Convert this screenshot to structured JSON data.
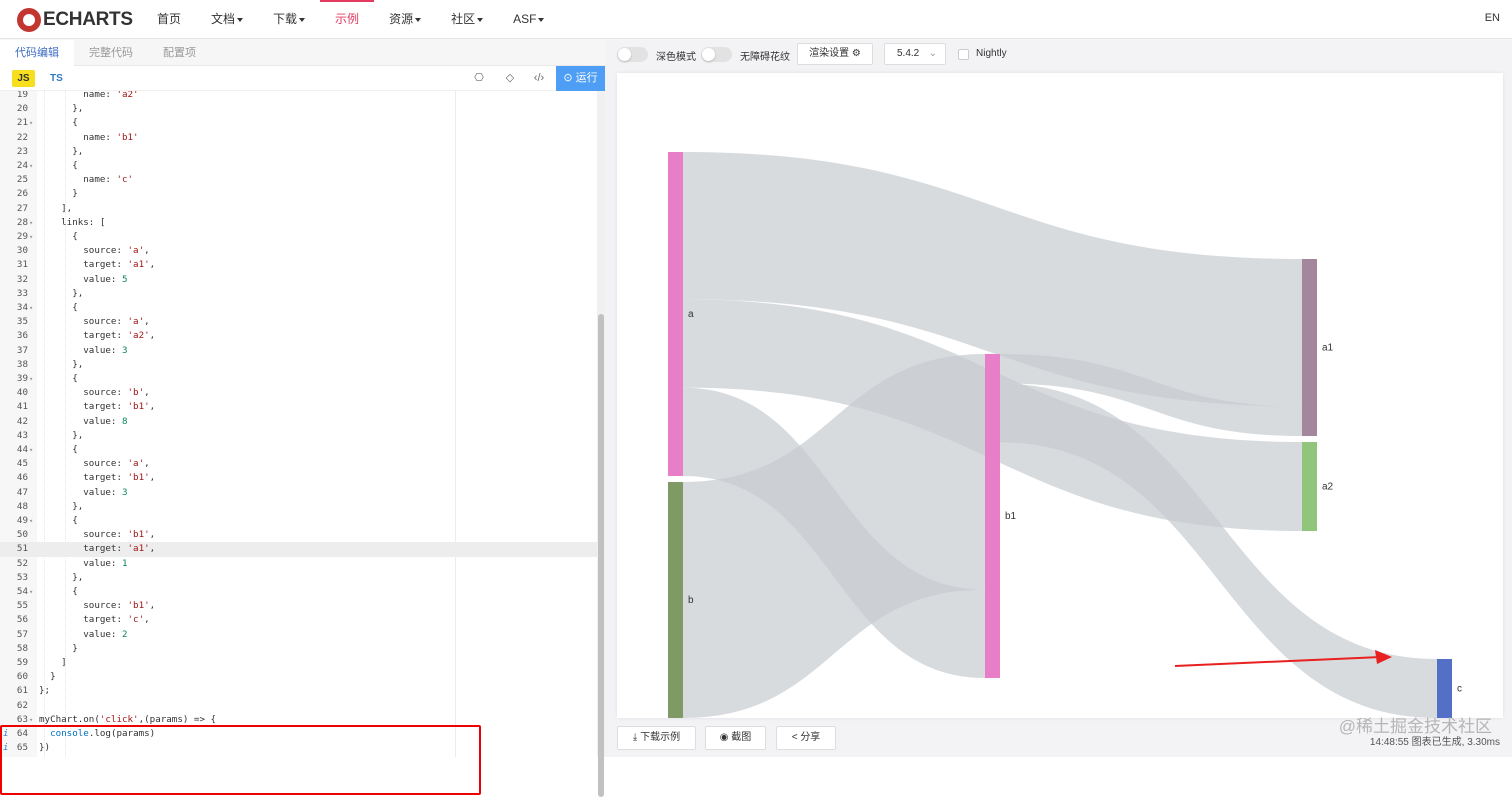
{
  "header": {
    "logo_text": "ECHARTS",
    "nav": [
      {
        "label": "首页",
        "dropdown": false,
        "active": false
      },
      {
        "label": "文档",
        "dropdown": true,
        "active": false
      },
      {
        "label": "下载",
        "dropdown": true,
        "active": false
      },
      {
        "label": "示例",
        "dropdown": false,
        "active": true
      },
      {
        "label": "资源",
        "dropdown": true,
        "active": false
      },
      {
        "label": "社区",
        "dropdown": true,
        "active": false
      },
      {
        "label": "ASF",
        "dropdown": true,
        "active": false
      }
    ],
    "lang": "EN",
    "accent_color": "#e43961"
  },
  "editor": {
    "tabs": [
      "代码编辑",
      "完整代码",
      "配置项"
    ],
    "lang_js": "JS",
    "lang_ts": "TS",
    "run_label": "运行",
    "lines": [
      {
        "no": "19",
        "text": "        name: 'a2'",
        "fold": false
      },
      {
        "no": "20",
        "text": "      },",
        "fold": false
      },
      {
        "no": "21",
        "text": "      {",
        "fold": true
      },
      {
        "no": "22",
        "text": "        name: 'b1'",
        "fold": false
      },
      {
        "no": "23",
        "text": "      },",
        "fold": false
      },
      {
        "no": "24",
        "text": "      {",
        "fold": true
      },
      {
        "no": "25",
        "text": "        name: 'c'",
        "fold": false
      },
      {
        "no": "26",
        "text": "      }",
        "fold": false
      },
      {
        "no": "27",
        "text": "    ],",
        "fold": false
      },
      {
        "no": "28",
        "text": "    links: [",
        "fold": true
      },
      {
        "no": "29",
        "text": "      {",
        "fold": true
      },
      {
        "no": "30",
        "text": "        source: 'a',",
        "fold": false
      },
      {
        "no": "31",
        "text": "        target: 'a1',",
        "fold": false
      },
      {
        "no": "32",
        "text": "        value: 5",
        "fold": false
      },
      {
        "no": "33",
        "text": "      },",
        "fold": false
      },
      {
        "no": "34",
        "text": "      {",
        "fold": true
      },
      {
        "no": "35",
        "text": "        source: 'a',",
        "fold": false
      },
      {
        "no": "36",
        "text": "        target: 'a2',",
        "fold": false
      },
      {
        "no": "37",
        "text": "        value: 3",
        "fold": false
      },
      {
        "no": "38",
        "text": "      },",
        "fold": false
      },
      {
        "no": "39",
        "text": "      {",
        "fold": true
      },
      {
        "no": "40",
        "text": "        source: 'b',",
        "fold": false
      },
      {
        "no": "41",
        "text": "        target: 'b1',",
        "fold": false
      },
      {
        "no": "42",
        "text": "        value: 8",
        "fold": false
      },
      {
        "no": "43",
        "text": "      },",
        "fold": false
      },
      {
        "no": "44",
        "text": "      {",
        "fold": true
      },
      {
        "no": "45",
        "text": "        source: 'a',",
        "fold": false
      },
      {
        "no": "46",
        "text": "        target: 'b1',",
        "fold": false
      },
      {
        "no": "47",
        "text": "        value: 3",
        "fold": false
      },
      {
        "no": "48",
        "text": "      },",
        "fold": false
      },
      {
        "no": "49",
        "text": "      {",
        "fold": true
      },
      {
        "no": "50",
        "text": "        source: 'b1',",
        "fold": false
      },
      {
        "no": "51",
        "text": "        target: 'a1',",
        "fold": false,
        "highlight": true
      },
      {
        "no": "52",
        "text": "        value: 1",
        "fold": false
      },
      {
        "no": "53",
        "text": "      },",
        "fold": false
      },
      {
        "no": "54",
        "text": "      {",
        "fold": true
      },
      {
        "no": "55",
        "text": "        source: 'b1',",
        "fold": false
      },
      {
        "no": "56",
        "text": "        target: 'c',",
        "fold": false
      },
      {
        "no": "57",
        "text": "        value: 2",
        "fold": false
      },
      {
        "no": "58",
        "text": "      }",
        "fold": false
      },
      {
        "no": "59",
        "text": "    ]",
        "fold": false
      },
      {
        "no": "60",
        "text": "  }",
        "fold": false
      },
      {
        "no": "61",
        "text": "};",
        "fold": false
      },
      {
        "no": "62",
        "text": "",
        "fold": false
      },
      {
        "no": "63",
        "text": "myChart.on('click',(params) => {",
        "fold": true
      },
      {
        "no": "64",
        "text": "  console.log(params)",
        "fold": false,
        "info": true
      },
      {
        "no": "65",
        "text": "})",
        "fold": false,
        "info": true
      }
    ]
  },
  "preview": {
    "dark_mode_label": "深色模式",
    "decal_label": "无障碍花纹",
    "render_settings_label": "渲染设置",
    "version": "5.4.2",
    "nightly_label": "Nightly",
    "download_label": "下载示例",
    "screenshot_label": "截图",
    "share_label": "分享",
    "status_time": "14:48:55",
    "status_text": "图表已生成, 3.30ms",
    "watermark": "@稀土掘金技术社区"
  },
  "chart_data": {
    "type": "sankey",
    "nodes": [
      {
        "name": "a",
        "color": "#e87dc8"
      },
      {
        "name": "b",
        "color": "#7f9a65"
      },
      {
        "name": "a1",
        "color": "#a4879d"
      },
      {
        "name": "a2",
        "color": "#90c57b"
      },
      {
        "name": "b1",
        "color": "#e87dc8"
      },
      {
        "name": "c",
        "color": "#5470c6"
      }
    ],
    "links": [
      {
        "source": "a",
        "target": "a1",
        "value": 5
      },
      {
        "source": "a",
        "target": "a2",
        "value": 3
      },
      {
        "source": "b",
        "target": "b1",
        "value": 8
      },
      {
        "source": "a",
        "target": "b1",
        "value": 3
      },
      {
        "source": "b1",
        "target": "a1",
        "value": 1
      },
      {
        "source": "b1",
        "target": "c",
        "value": 2
      }
    ],
    "link_color": "#c8ccd0"
  }
}
